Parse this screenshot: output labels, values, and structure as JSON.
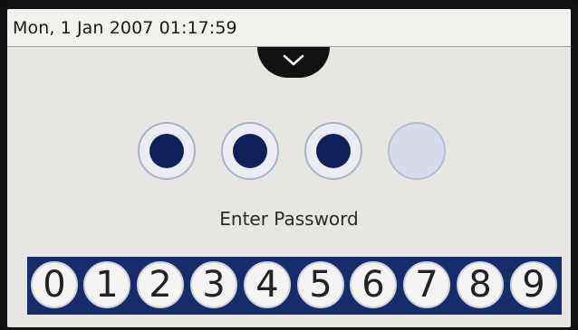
{
  "status_bar": {
    "datetime": "Mon, 1 Jan 2007 01:17:59"
  },
  "pulldown_tab": {
    "icon": "chevron-down-icon"
  },
  "password": {
    "length": 4,
    "entered": 3,
    "prompt": "Enter Password"
  },
  "keypad": {
    "keys": [
      "0",
      "1",
      "2",
      "3",
      "4",
      "5",
      "6",
      "7",
      "8",
      "9"
    ]
  },
  "colors": {
    "filled_dot": "#10205a",
    "keypad_bar": "#162c6b",
    "screen_bg": "#e7e6e2"
  }
}
